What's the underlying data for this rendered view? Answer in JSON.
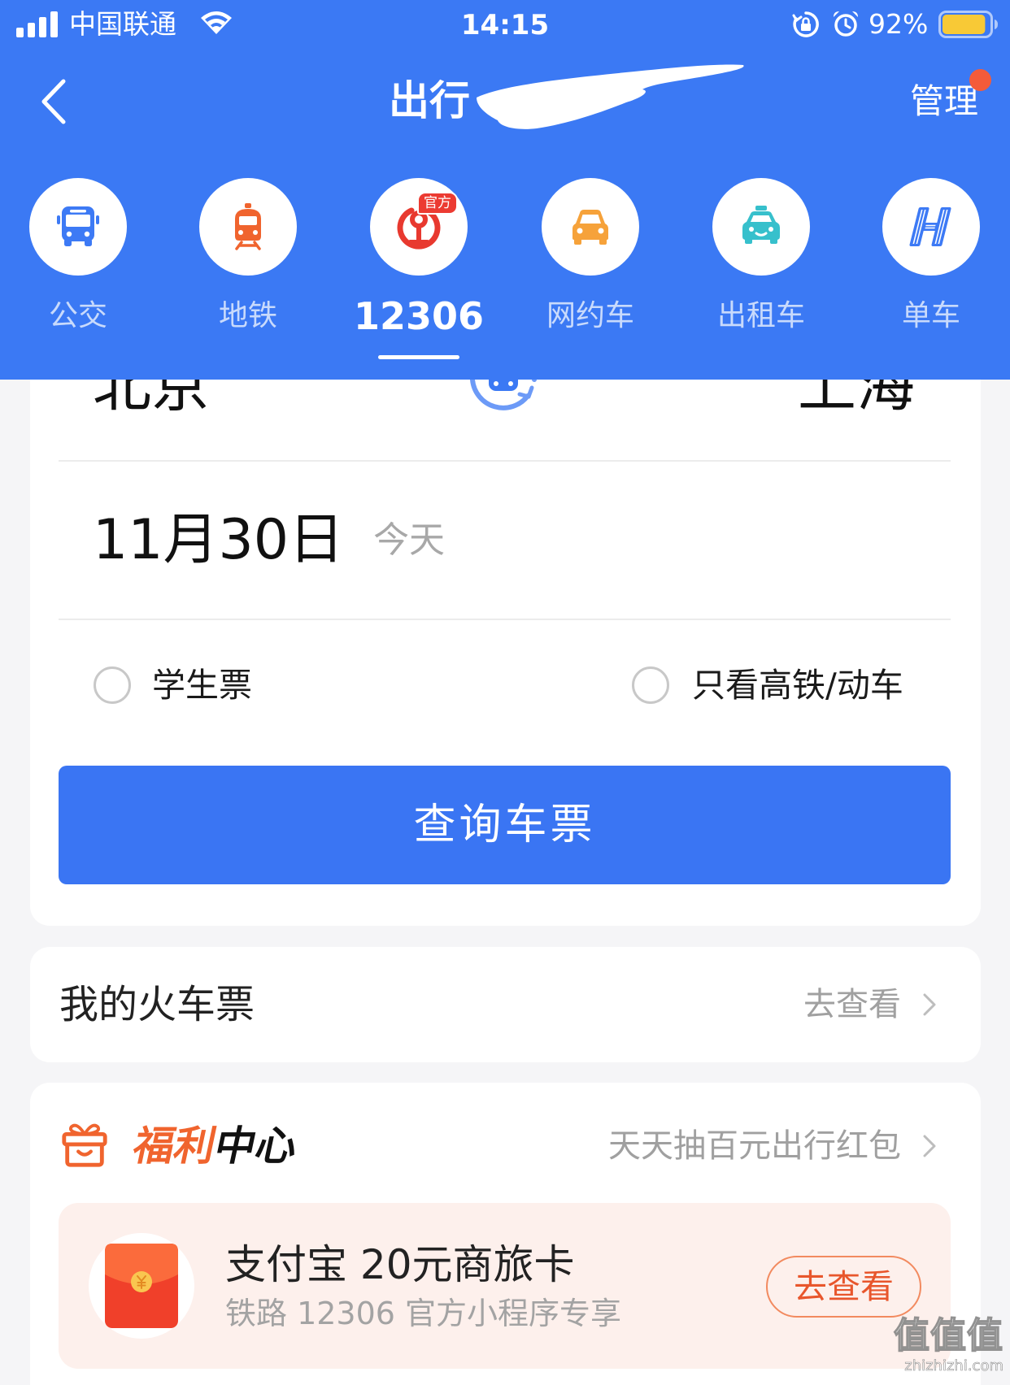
{
  "status_bar": {
    "carrier": "中国联通",
    "time": "14:15",
    "battery_text": "92%",
    "battery_level": 0.92,
    "icons": [
      "signal-icon",
      "wifi-icon",
      "orientation-lock-icon",
      "alarm-icon",
      "battery-icon"
    ]
  },
  "nav": {
    "back_icon": "chevron-left-icon",
    "title": "出行",
    "manage": "管理",
    "manage_has_dot": true
  },
  "categories": [
    {
      "label": "公交",
      "icon": "bus-icon",
      "color": "#3d7af5",
      "selected": false
    },
    {
      "label": "地铁",
      "icon": "subway-icon",
      "color": "#f0642e",
      "selected": false
    },
    {
      "label": "12306",
      "icon": "china-railway-icon",
      "color": "#e8392f",
      "selected": true,
      "badge": "官方"
    },
    {
      "label": "网约车",
      "icon": "car-icon",
      "color": "#f6a23a",
      "selected": false
    },
    {
      "label": "出租车",
      "icon": "taxi-icon",
      "color": "#37c0cc",
      "selected": false
    },
    {
      "label": "单车",
      "icon": "hellobike-icon",
      "color": "#3d7af5",
      "selected": false
    }
  ],
  "search": {
    "from_city": "北京",
    "to_city": "上海",
    "swap_icon": "swap-icon",
    "date": "11月30日",
    "date_hint": "今天",
    "options": [
      {
        "label": "学生票",
        "checked": false
      },
      {
        "label": "只看高铁/动车",
        "checked": false
      }
    ],
    "submit": "查询车票"
  },
  "my_tickets": {
    "title": "我的火车票",
    "link": "去查看"
  },
  "welfare": {
    "icon": "gift-icon",
    "title_highlight": "福利",
    "title_rest": "中心",
    "link": "天天抽百元出行红包",
    "promo": {
      "icon": "red-envelope-icon",
      "title": "支付宝 20元商旅卡",
      "subtitle": "铁路 12306 官方小程序专享",
      "button": "去查看"
    }
  },
  "watermark": {
    "mark": "值值值",
    "url": "zhizhizhi.com"
  },
  "colors": {
    "header_bg": "#3b79f4",
    "primary_button": "#3a75f3",
    "page_bg": "#f5f5f7",
    "accent_orange": "#f0642e",
    "promo_bg": "#fdf0ec",
    "notification_dot": "#f45b3a",
    "battery_fill": "#f8c936"
  }
}
